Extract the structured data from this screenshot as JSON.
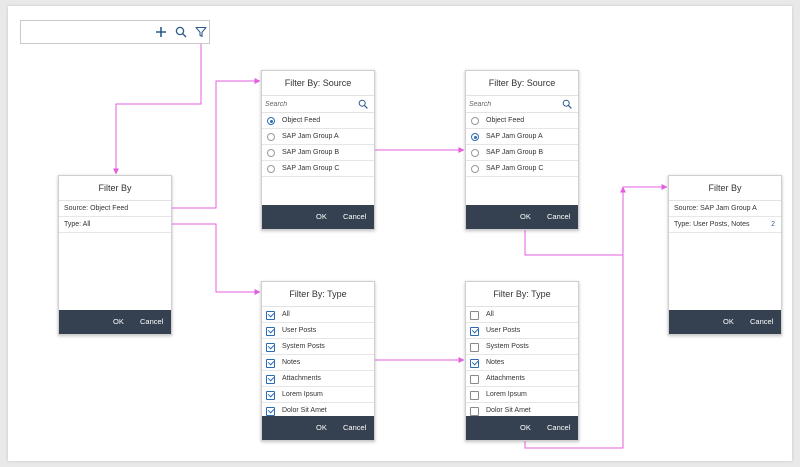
{
  "colors": {
    "accent": "#2d6cb5",
    "footer": "#354150",
    "wire": "#e45fe0"
  },
  "dialogs": {
    "filter_by_start": {
      "title": "Filter By",
      "rows": [
        "Source: Object Feed",
        "Type: All"
      ],
      "ok": "OK",
      "cancel": "Cancel"
    },
    "source_1": {
      "title": "Filter By: Source",
      "search_placeholder": "Search",
      "options": [
        {
          "label": "Object Feed",
          "selected": true
        },
        {
          "label": "SAP Jam Group A",
          "selected": false
        },
        {
          "label": "SAP Jam Group B",
          "selected": false
        },
        {
          "label": "SAP Jam Group C",
          "selected": false
        }
      ],
      "ok": "OK",
      "cancel": "Cancel"
    },
    "source_2": {
      "title": "Filter By: Source",
      "search_placeholder": "Search",
      "options": [
        {
          "label": "Object Feed",
          "selected": false
        },
        {
          "label": "SAP Jam Group A",
          "selected": true
        },
        {
          "label": "SAP Jam Group B",
          "selected": false
        },
        {
          "label": "SAP Jam Group C",
          "selected": false
        }
      ],
      "ok": "OK",
      "cancel": "Cancel"
    },
    "type_1": {
      "title": "Filter By: Type",
      "options": [
        {
          "label": "All",
          "checked": true
        },
        {
          "label": "User Posts",
          "checked": true
        },
        {
          "label": "System Posts",
          "checked": true
        },
        {
          "label": "Notes",
          "checked": true
        },
        {
          "label": "Attachments",
          "checked": true
        },
        {
          "label": "Lorem Ipsum",
          "checked": true
        },
        {
          "label": "Dolor Sit Amet",
          "checked": true
        }
      ],
      "ok": "OK",
      "cancel": "Cancel"
    },
    "type_2": {
      "title": "Filter By: Type",
      "options": [
        {
          "label": "All",
          "checked": false
        },
        {
          "label": "User Posts",
          "checked": true
        },
        {
          "label": "System Posts",
          "checked": false
        },
        {
          "label": "Notes",
          "checked": true
        },
        {
          "label": "Attachments",
          "checked": false
        },
        {
          "label": "Lorem Ipsum",
          "checked": false
        },
        {
          "label": "Dolor Sit Amet",
          "checked": false
        }
      ],
      "ok": "OK",
      "cancel": "Cancel"
    },
    "filter_by_end": {
      "title": "Filter By",
      "rows": [
        "Source: SAP Jam Group A",
        "Type: User Posts, Notes"
      ],
      "type_count": "2",
      "ok": "OK",
      "cancel": "Cancel"
    }
  },
  "toolbar": {
    "icons": [
      "add-icon",
      "search-icon",
      "filter-icon"
    ]
  }
}
